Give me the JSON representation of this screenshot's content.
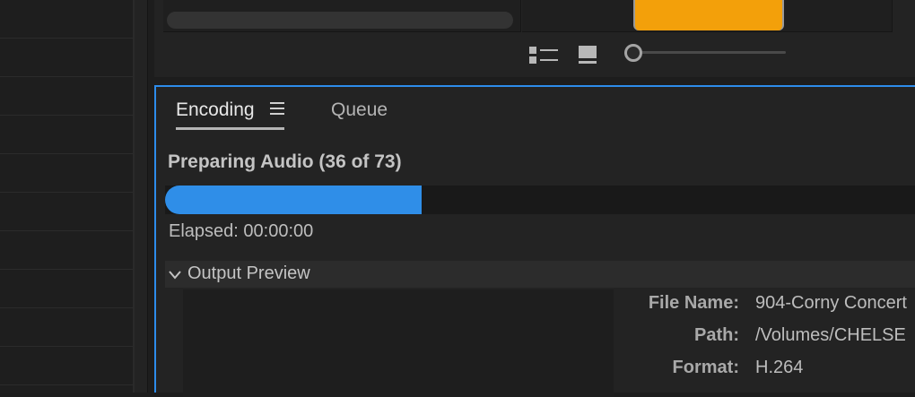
{
  "tabs": {
    "encoding": "Encoding",
    "queue": "Queue"
  },
  "encoding": {
    "status": "Preparing Audio (36 of 73)",
    "progress_fraction": 0.342,
    "elapsed": "Elapsed: 00:00:00"
  },
  "output_preview": {
    "title": "Output Preview",
    "properties": [
      {
        "label": "File Name:",
        "value": "904-Corny Concert"
      },
      {
        "label": "Path:",
        "value": "/Volumes/CHELSE"
      },
      {
        "label": "Format:",
        "value": "H.264"
      }
    ]
  },
  "icons": {
    "list_view": "list-view-icon",
    "icon_view": "icon-view-icon",
    "panel_menu": "hamburger-icon",
    "collapse": "chevron-down-icon"
  },
  "colors": {
    "accent": "#2d8ceb",
    "progress": "#2f8ee8",
    "thumbnail": "#f3a00a"
  }
}
